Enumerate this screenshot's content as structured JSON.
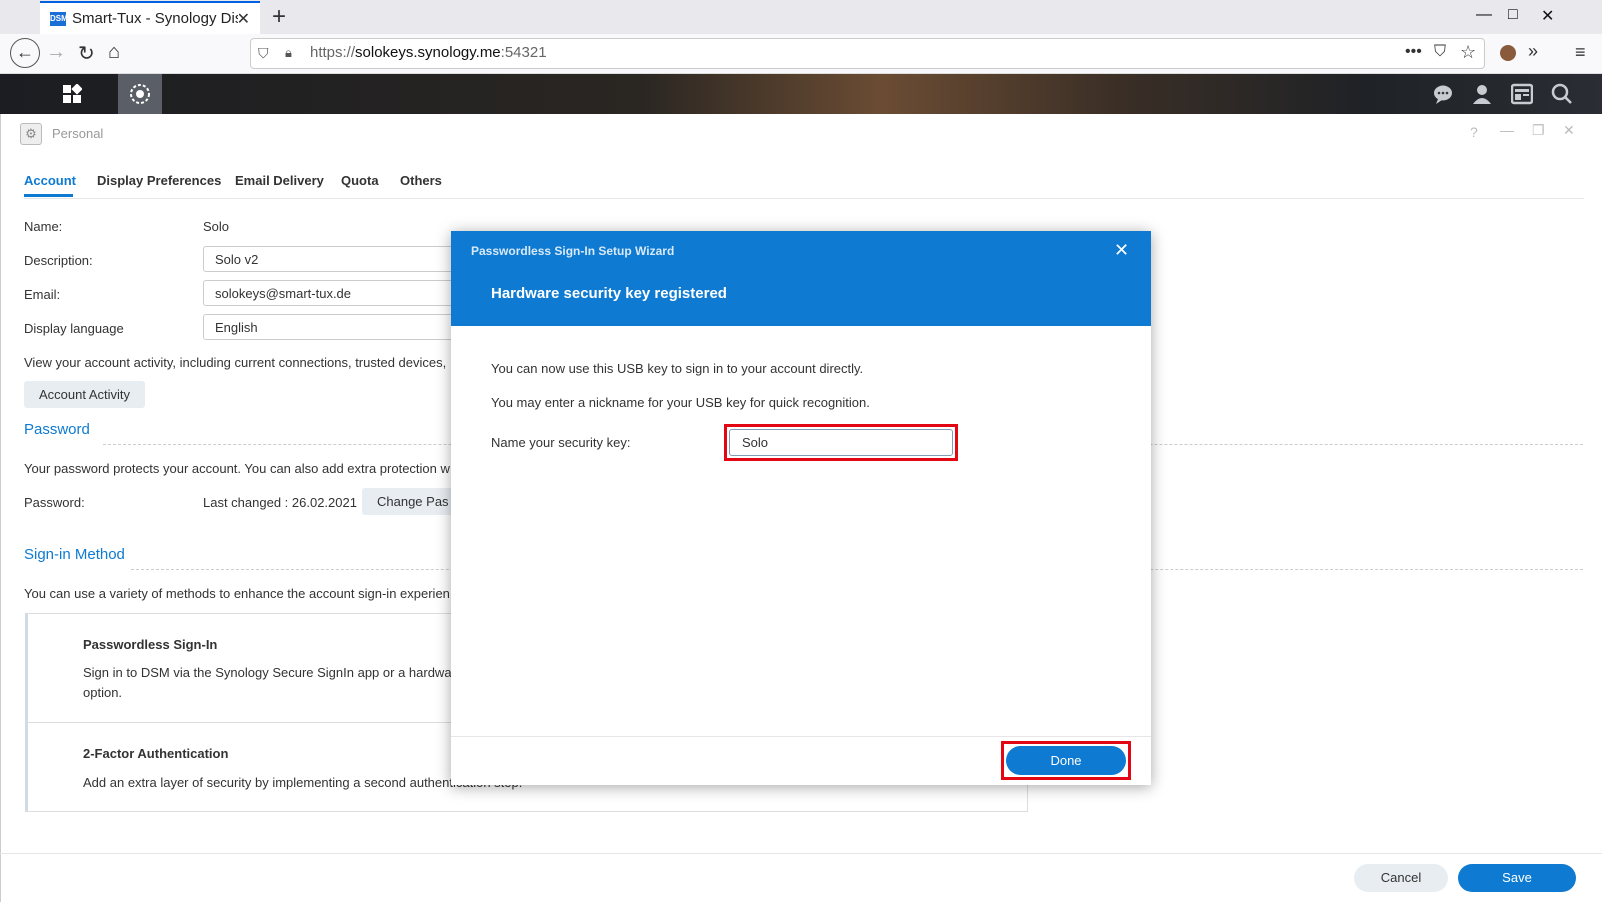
{
  "browser": {
    "tab_title": "Smart-Tux - Synology DiskStation",
    "favicon_text": "DSM",
    "url_prefix": "https://",
    "url_host": "solokeys.synology.me",
    "url_port": ":54321"
  },
  "window": {
    "title": "Personal",
    "tabs": [
      "Account",
      "Display Preferences",
      "Email Delivery",
      "Quota",
      "Others"
    ],
    "active_tab": "Account"
  },
  "account": {
    "name_label": "Name:",
    "name_value": "Solo",
    "description_label": "Description:",
    "description_value": "Solo v2",
    "email_label": "Email:",
    "email_value": "solokeys@smart-tux.de",
    "language_label": "Display language",
    "language_value": "English",
    "activity_text": "View your account activity, including current connections, trusted devices,",
    "activity_button": "Account Activity"
  },
  "password": {
    "heading": "Password",
    "desc": "Your password protects your account. You can also add extra protection w",
    "label": "Password:",
    "last_changed": "Last changed : 26.02.2021",
    "change_button": "Change Pas"
  },
  "signin": {
    "heading": "Sign-in Method",
    "desc": "You can use a variety of methods to enhance the account sign-in experien",
    "cards": [
      {
        "title": "Passwordless Sign-In",
        "text": "Sign in to DSM via the Synology Secure SignIn app or a hardwa",
        "text2": "option."
      },
      {
        "title": "2-Factor Authentication",
        "text": "Add an extra layer of security by implementing a second authentication step."
      }
    ]
  },
  "footer": {
    "cancel": "Cancel",
    "save": "Save"
  },
  "dialog": {
    "wizard_title": "Passwordless Sign-In Setup Wizard",
    "heading": "Hardware security key registered",
    "line1": "You can now use this USB key to sign in to your account directly.",
    "line2": "You may enter a nickname for your USB key for quick recognition.",
    "key_label": "Name your security key:",
    "key_value": "Solo",
    "done": "Done"
  },
  "colors": {
    "accent": "#0e7ad1",
    "highlight": "#e30613"
  }
}
